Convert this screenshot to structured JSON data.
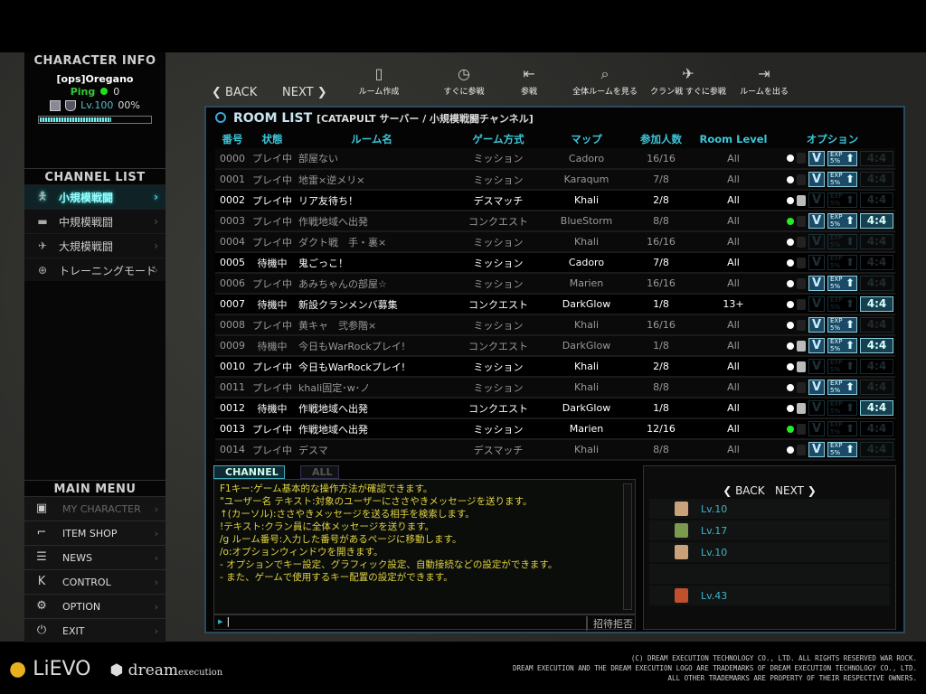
{
  "character": {
    "title": "CHARACTER INFO",
    "name": "[ops]Oregano",
    "ping_label": "Ping",
    "ping_value": "0",
    "level": "Lv.100",
    "exp": "00%",
    "exp_fraction": 0.65
  },
  "channels": {
    "title": "CHANNEL LIST",
    "items": [
      {
        "label": "小規模戦闘",
        "icon": "soldier-icon",
        "active": true
      },
      {
        "label": "中規模戦闘",
        "icon": "tank-icon"
      },
      {
        "label": "大規模戦闘",
        "icon": "jet-icon"
      },
      {
        "label": "トレーニングモード",
        "icon": "crosshair-icon"
      }
    ]
  },
  "menu": {
    "title": "MAIN MENU",
    "items": [
      {
        "label": "MY CHARACTER",
        "icon": "character-icon",
        "disabled": true
      },
      {
        "label": "ITEM SHOP",
        "icon": "gun-icon"
      },
      {
        "label": "NEWS",
        "icon": "news-icon"
      },
      {
        "label": "CONTROL",
        "icon": "keyboard-icon"
      },
      {
        "label": "OPTION",
        "icon": "gear-icon"
      },
      {
        "label": "EXIT",
        "icon": "power-icon"
      }
    ]
  },
  "toolbar": {
    "back": "BACK",
    "next": "NEXT",
    "buttons": [
      {
        "label": "ルーム作成",
        "icon": "door-icon"
      },
      {
        "label": "すぐに参戦",
        "icon": "quick-join-icon"
      },
      {
        "label": "参戦",
        "icon": "join-icon"
      },
      {
        "label": "全体ルームを見る",
        "icon": "search-icon"
      },
      {
        "label": "クラン戦 すぐに参戦",
        "icon": "plane-icon"
      },
      {
        "label": "ルームを出る",
        "icon": "exit-door-icon"
      }
    ]
  },
  "roomlist": {
    "title": "ROOM LIST",
    "subtitle": "[CATAPULT サーバー / 小規模戦闘チャンネル]",
    "columns": [
      "番号",
      "状態",
      "ルーム名",
      "ゲーム方式",
      "マップ",
      "参加人数",
      "Room Level",
      "オプション"
    ],
    "rows": [
      [
        "0000",
        "プレイ中",
        "部屋ない",
        "ミッション",
        "Cadoro",
        "16/16",
        "All",
        0,
        "w",
        0,
        1,
        1,
        0
      ],
      [
        "0001",
        "プレイ中",
        "地雷×逆メリ×",
        "ミッション",
        "Karaqum",
        "7/8",
        "All",
        0,
        "w",
        0,
        1,
        1,
        0
      ],
      [
        "0002",
        "プレイ中",
        "リア友待ち！",
        "デスマッチ",
        "Khali",
        "2/8",
        "All",
        1,
        "w",
        1,
        0,
        0,
        0
      ],
      [
        "0003",
        "プレイ中",
        "作戦地域へ出発",
        "コンクエスト",
        "BlueStorm",
        "8/8",
        "All",
        0,
        "g",
        0,
        1,
        1,
        1
      ],
      [
        "0004",
        "プレイ中",
        "ダクト戦　手・裏×",
        "ミッション",
        "Khali",
        "16/16",
        "All",
        0,
        "w",
        0,
        0,
        0,
        0
      ],
      [
        "0005",
        "待機中",
        "鬼ごっこ！",
        "ミッション",
        "Cadoro",
        "7/8",
        "All",
        1,
        "w",
        0,
        0,
        0,
        0
      ],
      [
        "0006",
        "プレイ中",
        "あみちゃんの部屋☆",
        "ミッション",
        "Marien",
        "16/16",
        "All",
        0,
        "w",
        0,
        1,
        1,
        0
      ],
      [
        "0007",
        "待機中",
        "新設クランメンバ募集",
        "コンクエスト",
        "DarkGlow",
        "1/8",
        "13+",
        1,
        "w",
        0,
        0,
        0,
        1
      ],
      [
        "0008",
        "プレイ中",
        "黄キャ　弐参階×",
        "ミッション",
        "Khali",
        "16/16",
        "All",
        0,
        "w",
        0,
        1,
        1,
        0
      ],
      [
        "0009",
        "待機中",
        "今日もWarRockプレイ!",
        "コンクエスト",
        "DarkGlow",
        "1/8",
        "All",
        0,
        "w",
        1,
        1,
        1,
        1
      ],
      [
        "0010",
        "プレイ中",
        "今日もWarRockプレイ!",
        "ミッション",
        "Khali",
        "2/8",
        "All",
        1,
        "w",
        1,
        0,
        0,
        0
      ],
      [
        "0011",
        "プレイ中",
        "khali固定･w･ノ",
        "ミッション",
        "Khali",
        "8/8",
        "All",
        0,
        "w",
        0,
        1,
        1,
        0
      ],
      [
        "0012",
        "待機中",
        "作戦地域へ出発",
        "コンクエスト",
        "DarkGlow",
        "1/8",
        "All",
        1,
        "w",
        1,
        0,
        0,
        1
      ],
      [
        "0013",
        "プレイ中",
        "作戦地域へ出発",
        "ミッション",
        "Marien",
        "12/16",
        "All",
        1,
        "g",
        0,
        0,
        0,
        0
      ],
      [
        "0014",
        "プレイ中",
        "デスマ",
        "デスマッチ",
        "Khali",
        "8/8",
        "All",
        0,
        "w",
        0,
        1,
        1,
        0
      ]
    ],
    "opt_labels": {
      "v": "V",
      "exp": "EXP 5%",
      "ratio": "4:4"
    }
  },
  "chat": {
    "tab_channel": "CHANNEL",
    "tab_all": "ALL",
    "invite": "招待拒否",
    "lines": [
      "F1キー:ゲーム基本的な操作方法が確認できます。",
      "\"ユーザー名 テキスト:対象のユーザーにささやきメッセージを送ります。",
      "↑(カーソル):ささやきメッセージを送る相手を検索します。",
      "!テキスト:クラン員に全体メッセージを送ります。",
      "/g ルーム番号:入力した番号があるページに移動します。",
      "/o:オプションウィンドウを開きます。",
      "- オプションでキー設定、グラフィック設定、自動接続などの設定ができます。",
      "- また、ゲームで使用するキー配置の設定ができます。"
    ]
  },
  "users": {
    "back": "BACK",
    "next": "NEXT",
    "rows": [
      {
        "level": "Lv.10",
        "badge": "#c9a27a"
      },
      {
        "level": "Lv.17",
        "badge": "#7a9a50"
      },
      {
        "level": "Lv.10",
        "badge": "#c9a27a"
      },
      {
        "level": "",
        "badge": ""
      },
      {
        "level": "Lv.43",
        "badge": "#c0502e"
      }
    ]
  },
  "footer": {
    "logo1": "LiEVO",
    "logo2": "dreamexecution",
    "copyright": [
      "(C) DREAM EXECUTION TECHNOLOGY CO., LTD. ALL RIGHTS RESERVED WAR ROCK.",
      "DREAM EXECUTION AND THE DREAM EXECUTION LOGO ARE TRADEMARKS OF DREAM EXECUTION TECHNOLOGY CO., LTD.",
      "ALL OTHER TRADEMARKS ARE PROPERTY OF THEIR RESPECTIVE OWNERS."
    ]
  }
}
